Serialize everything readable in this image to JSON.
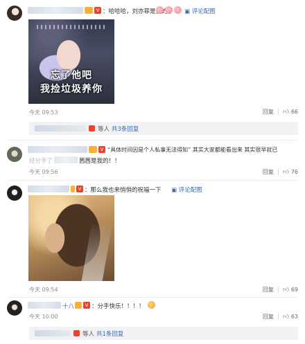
{
  "comments": [
    {
      "text": "：哈哈哈，刘亦菲是我的了",
      "view_image": "评论配图",
      "image_caption": [
        "忘了他吧",
        "我捡垃圾养你"
      ],
      "time": "今天 09:53",
      "reply_label": "回复",
      "likes": "66",
      "reply_box": {
        "suffix": "等人",
        "link": "共3条回复"
      }
    },
    {
      "text_line1": "“具体时间因是个人私事无法得知” 其实大家都能看出来 其实很早就已",
      "text_line2_prefix": "经分手了",
      "text_line2_suffix": "茜茜是我的！！",
      "time": "今天 09:56",
      "reply_label": "回复",
      "likes": "76"
    },
    {
      "text": "：那么我也来悄悄的祝福一下",
      "view_image": "评论配图",
      "time": "今天 09:54",
      "reply_label": "回复",
      "likes": "69"
    },
    {
      "name_partial": "十八",
      "text": "：分手快乐！！！！",
      "time": "今天 10:00",
      "reply_label": "回复",
      "likes": "63",
      "reply_box": {
        "suffix": "等人",
        "link": "共1条回复"
      }
    }
  ],
  "colors": {
    "link": "#3b6aa8",
    "vip": "#e8442b",
    "reply_bg": "#f2f2f5"
  },
  "icons": [
    "thumbs-up-icon",
    "picture-icon",
    "vip-badge-icon"
  ]
}
